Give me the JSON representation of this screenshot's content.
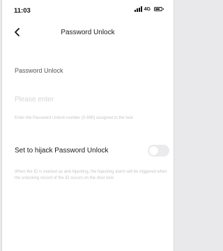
{
  "status_bar": {
    "time": "11:03",
    "network": "4G",
    "icons": [
      "signal-icon",
      "battery-icon"
    ]
  },
  "nav": {
    "back_icon": "chevron-left-icon",
    "title": "Password Unlock"
  },
  "form": {
    "section_label": "Password Unlock",
    "input_value": "",
    "input_placeholder": "Please enter",
    "hint": "Enter the Password Unlock number (0-990) assigned to the lock"
  },
  "hijack": {
    "label": "Set to hijack Password Unlock",
    "enabled": false,
    "note": "When the ID is marked as anti-hijacking, the hijacking alarm will be triggered when the unlocking record of the ID occurs on the door lock"
  },
  "colors": {
    "background": "#ffffff",
    "toggle_off": "#ebebee",
    "hint_text": "#c6c6ca"
  }
}
